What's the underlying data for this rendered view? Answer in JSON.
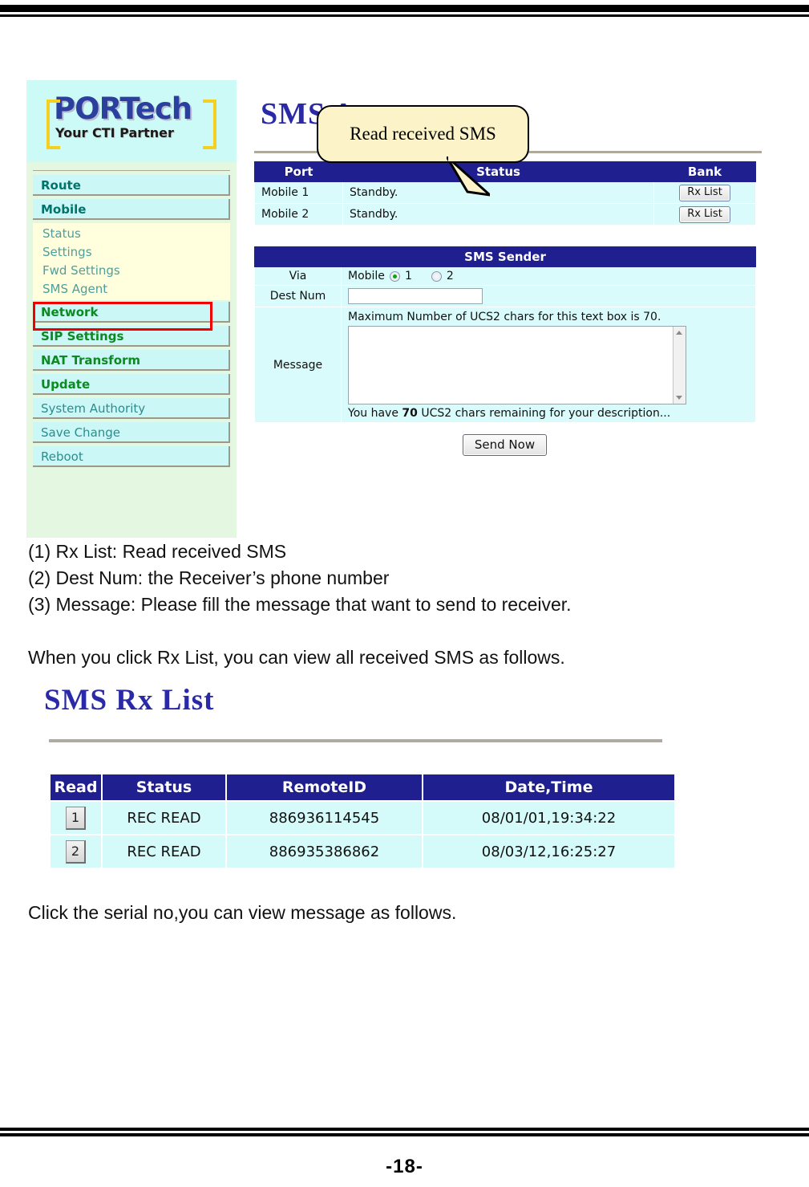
{
  "document": {
    "page_number": "-18-"
  },
  "screenshot_sms_agent": {
    "logo": {
      "main": "PORTech",
      "tagline": "Your CTI Partner"
    },
    "sidebar": {
      "items": [
        {
          "label": "Route",
          "style": "bold-teal"
        },
        {
          "label": "Mobile",
          "style": "bold-teal"
        }
      ],
      "submenu": [
        {
          "label": "Status"
        },
        {
          "label": "Settings"
        },
        {
          "label": "Fwd Settings"
        },
        {
          "label": "SMS Agent"
        }
      ],
      "items2": [
        {
          "label": "Network",
          "style": "green-bold"
        },
        {
          "label": "SIP Settings",
          "style": "green-bold"
        },
        {
          "label": "NAT Transform",
          "style": "green-bold"
        },
        {
          "label": "Update",
          "style": "green-bold"
        },
        {
          "label": "System Authority",
          "style": "plain"
        },
        {
          "label": "Save Change",
          "style": "plain"
        },
        {
          "label": "Reboot",
          "style": "plain"
        }
      ]
    },
    "page_title": "SMS Agent",
    "callout": {
      "text": "Read received SMS"
    },
    "port_table": {
      "headers": [
        "Port",
        "Status",
        "Bank"
      ],
      "rows": [
        {
          "port": "Mobile 1",
          "status": "Standby.",
          "bank": "Rx List"
        },
        {
          "port": "Mobile 2",
          "status": "Standby.",
          "bank": "Rx List"
        }
      ]
    },
    "sms_sender": {
      "title": "SMS Sender",
      "via_label": "Via",
      "via_prefix": "Mobile",
      "via_option_1": "1",
      "via_option_2": "2",
      "via_selected": "1",
      "dest_label": "Dest Num",
      "dest_value": "",
      "message_label": "Message",
      "message_hint": "Maximum Number of UCS2 chars for this text box is 70.",
      "message_value": "",
      "remaining_prefix": "You have",
      "remaining_count": "70",
      "remaining_suffix": "UCS2 chars remaining for your description...",
      "send_button": "Send Now"
    }
  },
  "body_text": {
    "line1": "(1) Rx List: Read received SMS",
    "line2": "(2) Dest Num: the Receiver’s phone number",
    "line3": "(3) Message: Please fill the message that want to send to receiver.",
    "line4": "When you click Rx List, you can view all received SMS as follows.",
    "line5": "Click the serial no,you can view message as follows."
  },
  "screenshot_rx_list": {
    "title": "SMS Rx List",
    "headers": [
      "Read",
      "Status",
      "RemoteID",
      "Date,Time"
    ],
    "rows": [
      {
        "read": "1",
        "status": "REC READ",
        "remote_id": "886936114545",
        "datetime": "08/01/01,19:34:22"
      },
      {
        "read": "2",
        "status": "REC READ",
        "remote_id": "886935386862",
        "datetime": "08/03/12,16:25:27"
      }
    ]
  }
}
